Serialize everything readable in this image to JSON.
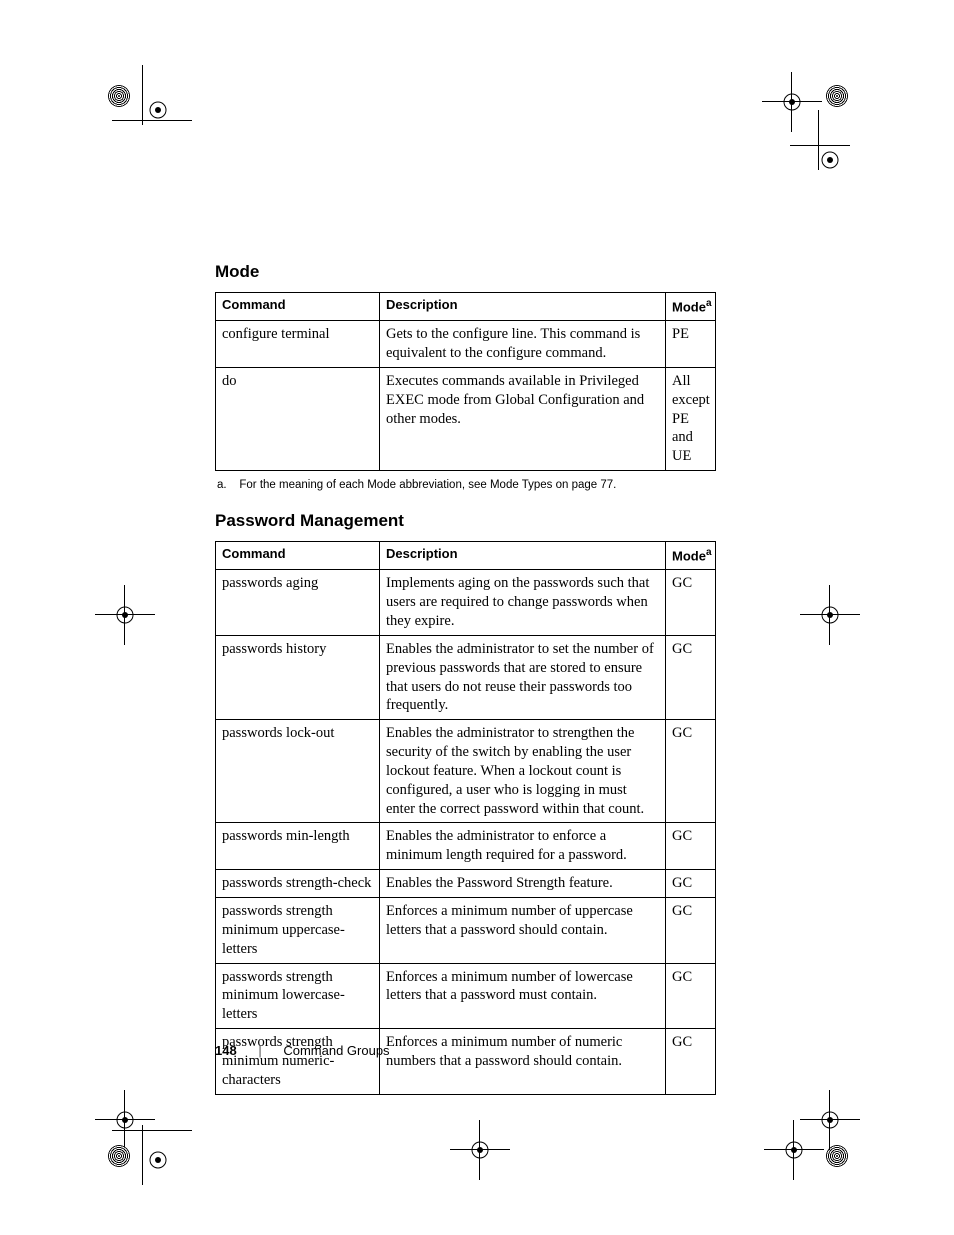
{
  "sections": {
    "mode": {
      "heading": "Mode",
      "headers": {
        "c1": "Command",
        "c2": "Description",
        "c3": "Mode",
        "c3_sup": "a"
      },
      "rows": [
        {
          "command": "configure terminal",
          "description": "Gets to the configure line. This command is equivalent to the configure command.",
          "mode": "PE"
        },
        {
          "command": "do",
          "description": "Executes commands available in Privileged EXEC mode from Global Configuration and other modes.",
          "mode": "All except PE and UE"
        }
      ],
      "footnote_label": "a.",
      "footnote_text": "For the meaning of each Mode abbreviation, see Mode Types on page 77."
    },
    "password": {
      "heading": "Password Management",
      "headers": {
        "c1": "Command",
        "c2": "Description",
        "c3": "Mode",
        "c3_sup": "a"
      },
      "rows": [
        {
          "command": "passwords aging",
          "description": "Implements aging on the passwords such that users are required to change passwords when they expire.",
          "mode": "GC"
        },
        {
          "command": "passwords history",
          "description": "Enables the administrator to set the number of previous passwords that are stored to ensure that users do not reuse their passwords too frequently.",
          "mode": "GC"
        },
        {
          "command": "passwords lock-out",
          "description": "Enables the administrator to strengthen the security of the switch by enabling the user lockout feature. When a lockout count is configured, a user who is logging in must enter the correct password within that count.",
          "mode": "GC"
        },
        {
          "command": "passwords min-length",
          "description": "Enables the administrator to enforce a minimum length required for a password.",
          "mode": "GC"
        },
        {
          "command": "passwords strength-check",
          "description": "Enables the Password Strength feature.",
          "mode": "GC"
        },
        {
          "command": "passwords strength minimum uppercase-letters",
          "description": "Enforces a minimum number of uppercase letters that a password should contain.",
          "mode": "GC"
        },
        {
          "command": "passwords strength minimum lowercase-letters",
          "description": "Enforces a minimum number of lowercase letters that a password must contain.",
          "mode": "GC"
        },
        {
          "command": "passwords strength minimum numeric-characters",
          "description": "Enforces a minimum number of numeric numbers that a password should contain.",
          "mode": "GC"
        }
      ]
    }
  },
  "footer": {
    "page_number": "148",
    "section": "Command Groups"
  }
}
